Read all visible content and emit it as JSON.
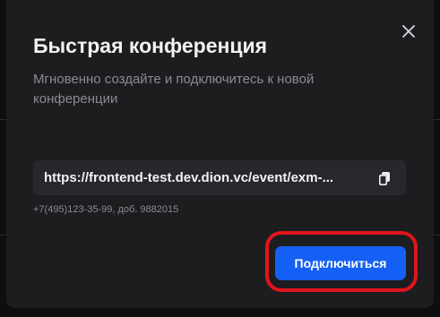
{
  "dialog": {
    "title": "Быстрая конференция",
    "subtitle": "Мгновенно создайте и подключитесь к новой конференции",
    "link": "https://frontend-test.dev.dion.vc/event/exm-...",
    "phone": "+7(495)123-35-99, доб. 9882015",
    "connect_label": "Подключиться",
    "close_icon": "close-icon",
    "copy_icon": "copy-icon"
  },
  "colors": {
    "modal_bg": "#1d1d20",
    "primary_button": "#1560f4",
    "highlight": "#e0141c",
    "text_primary": "#f2f2f4",
    "text_secondary": "#8a8b91"
  }
}
